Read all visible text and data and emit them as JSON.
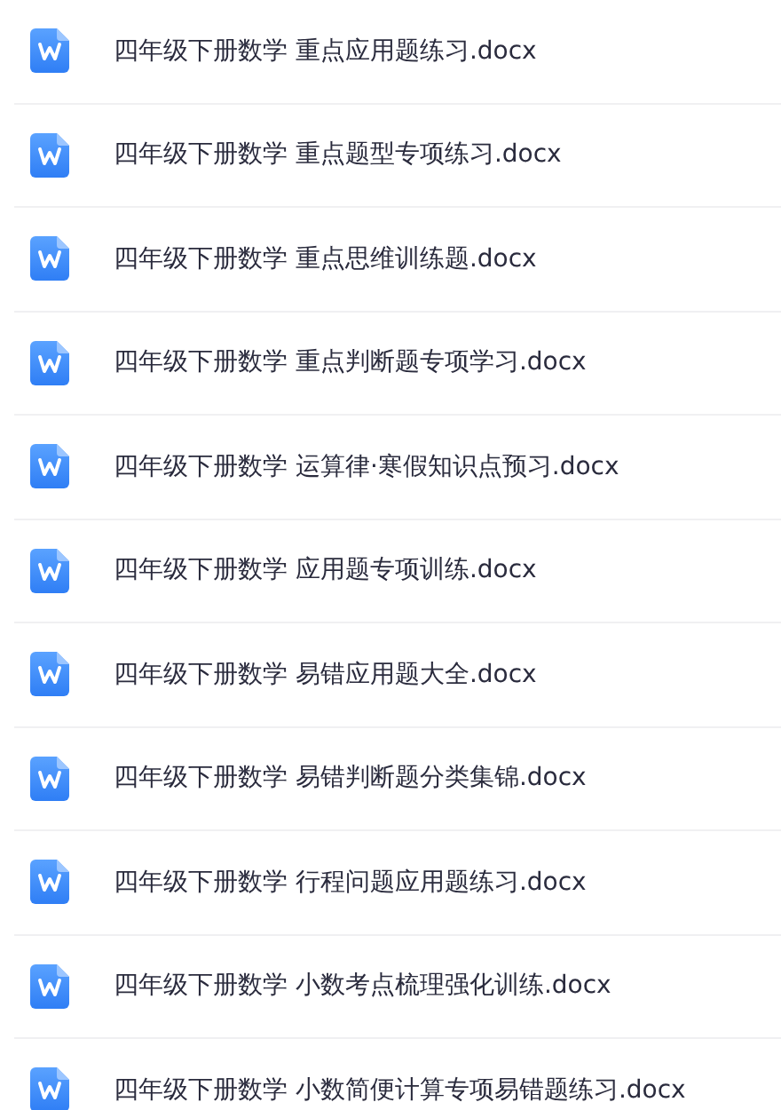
{
  "files": [
    {
      "name": "四年级下册数学 重点应用题练习.docx"
    },
    {
      "name": "四年级下册数学 重点题型专项练习.docx"
    },
    {
      "name": "四年级下册数学 重点思维训练题.docx"
    },
    {
      "name": "四年级下册数学 重点判断题专项学习.docx"
    },
    {
      "name": "四年级下册数学 运算律·寒假知识点预习.docx"
    },
    {
      "name": "四年级下册数学 应用题专项训练.docx"
    },
    {
      "name": "四年级下册数学 易错应用题大全.docx"
    },
    {
      "name": "四年级下册数学 易错判断题分类集锦.docx"
    },
    {
      "name": "四年级下册数学 行程问题应用题练习.docx"
    },
    {
      "name": "四年级下册数学 小数考点梳理强化训练.docx"
    },
    {
      "name": "四年级下册数学 小数简便计算专项易错题练习.docx"
    }
  ]
}
